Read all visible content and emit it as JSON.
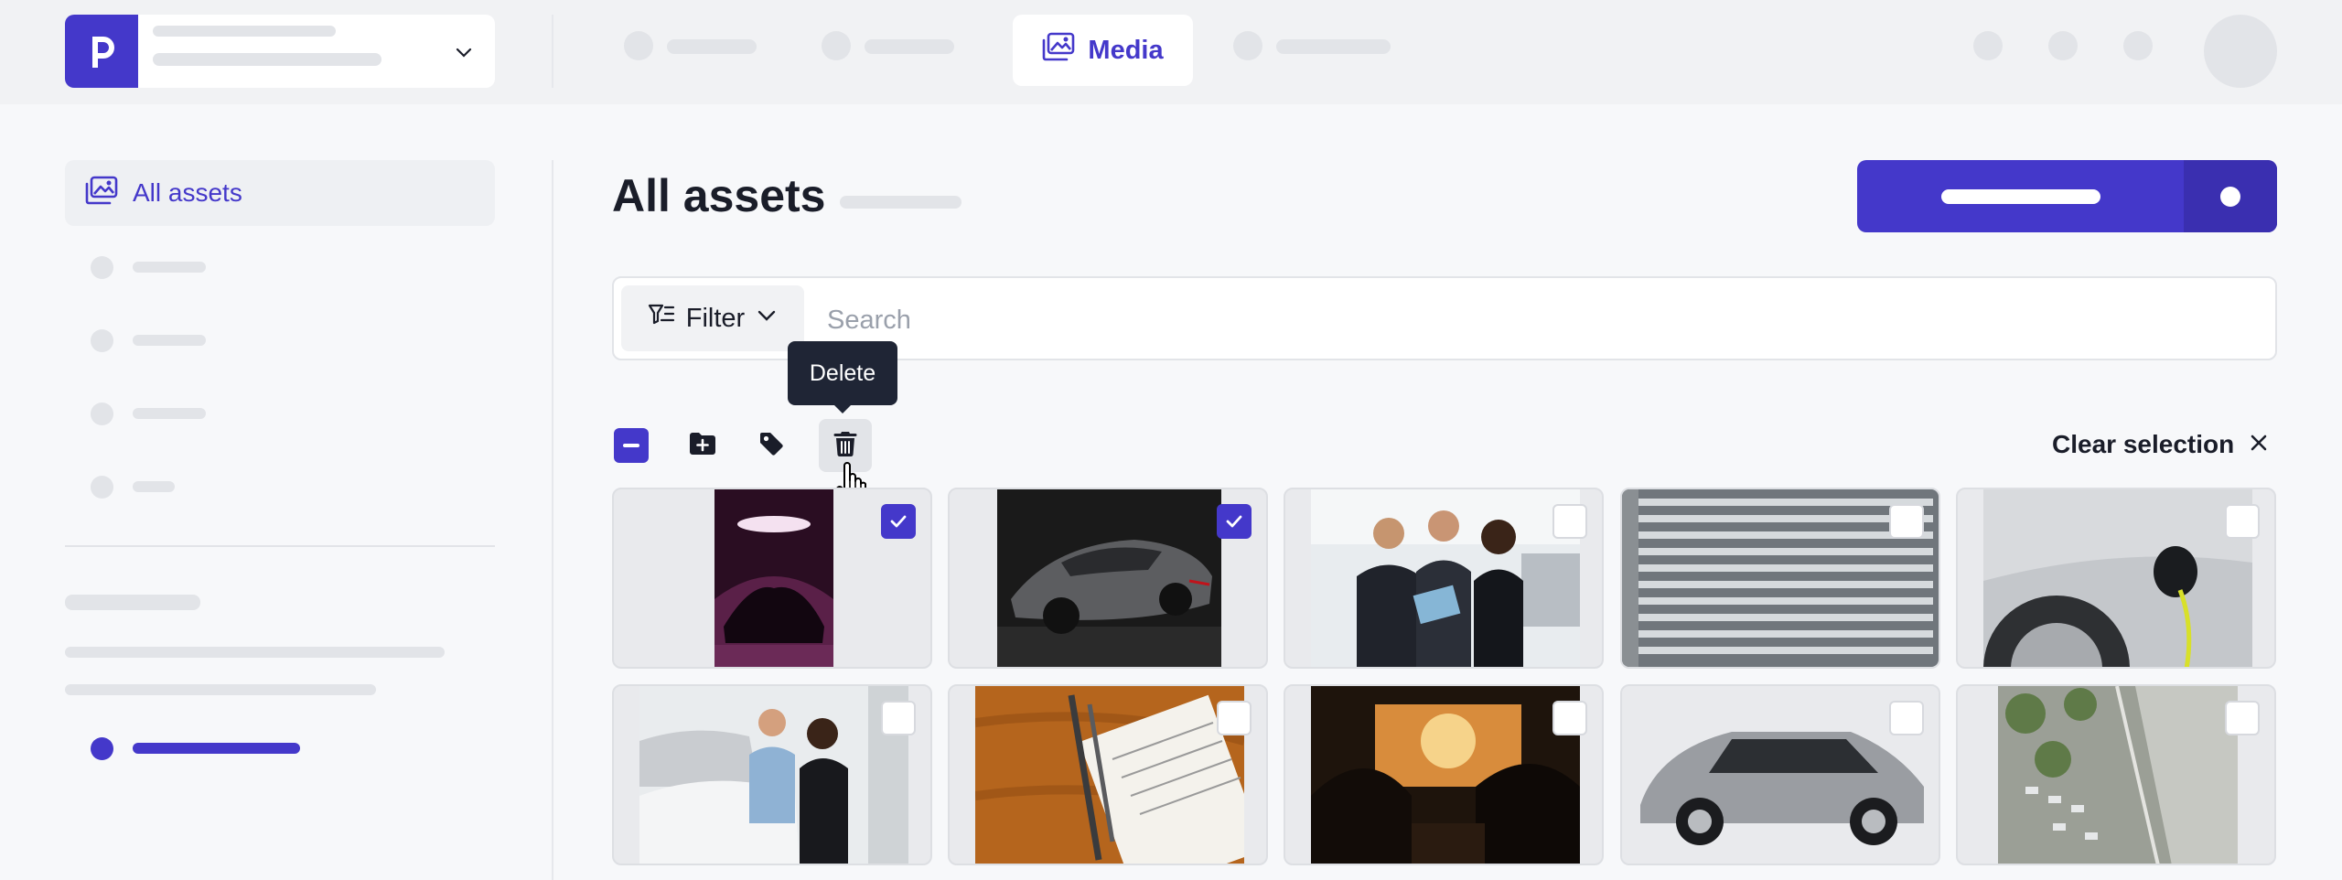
{
  "header": {
    "active_tab": "Media"
  },
  "sidebar": {
    "active_item": "All assets"
  },
  "main": {
    "title": "All assets",
    "filter_label": "Filter",
    "search_placeholder": "Search",
    "tooltip": "Delete",
    "clear_selection": "Clear selection"
  },
  "assets": [
    {
      "subject": "dark sports car in showroom",
      "selected": true
    },
    {
      "subject": "black sports car",
      "selected": true
    },
    {
      "subject": "people in car dealership",
      "selected": false
    },
    {
      "subject": "car parking lot aerial",
      "selected": false
    },
    {
      "subject": "electric car charging",
      "selected": false
    },
    {
      "subject": "couple looking at white car",
      "selected": false
    },
    {
      "subject": "lease agreement with pen",
      "selected": false
    },
    {
      "subject": "driver inside car",
      "selected": false
    },
    {
      "subject": "silver station wagon",
      "selected": false
    },
    {
      "subject": "parking lot from above",
      "selected": false
    }
  ],
  "colors": {
    "accent": "#4438ca",
    "tooltip_bg": "#1f2535"
  }
}
